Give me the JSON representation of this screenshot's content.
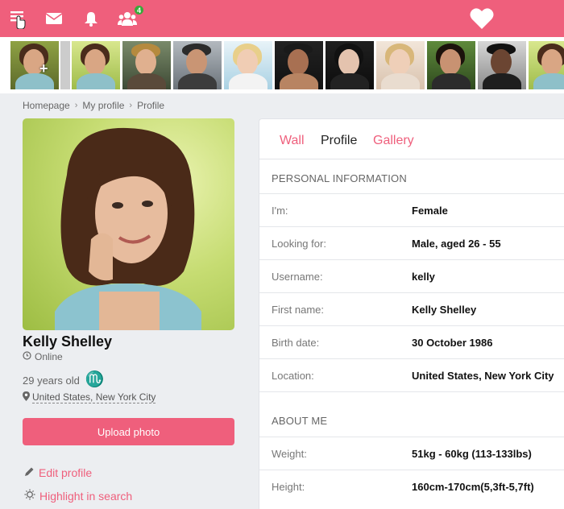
{
  "topbar": {
    "menu_icon": "hamburger-menu-icon",
    "mail_icon": "envelope-icon",
    "bell_icon": "bell-icon",
    "group_icon": "group-users-icon",
    "group_badge": "4",
    "heart_icon": "heart-logo-icon",
    "bg_color": "#ef5f7c"
  },
  "breadcrumb": {
    "items": [
      "Homepage",
      "My profile",
      "Profile"
    ]
  },
  "profile": {
    "name": "Kelly Shelley",
    "status": "Online",
    "age": "29 years old",
    "zodiac_symbol": "♏",
    "location": "United States, New York City",
    "upload_label": "Upload photo",
    "edit_label": "Edit profile",
    "highlight_label": "Highlight in search"
  },
  "tabs": [
    "Wall",
    "Profile",
    "Gallery"
  ],
  "personal": {
    "heading": "PERSONAL INFORMATION",
    "rows": [
      {
        "label": "I'm:",
        "value": "Female"
      },
      {
        "label": "Looking for:",
        "value": "Male, aged 26 - 55"
      },
      {
        "label": "Username:",
        "value": "kelly"
      },
      {
        "label": "First name:",
        "value": "Kelly Shelley"
      },
      {
        "label": "Birth date:",
        "value": "30 October 1986"
      },
      {
        "label": "Location:",
        "value": "United States, New York City"
      }
    ]
  },
  "about": {
    "heading": "ABOUT ME",
    "rows": [
      {
        "label": "Weight:",
        "value": "51kg - 60kg (113-133lbs)"
      },
      {
        "label": "Height:",
        "value": "160cm-170cm(5,3ft-5,7ft)"
      }
    ]
  },
  "colors": {
    "accent": "#ef5f7c",
    "online_green": "#3aa83a",
    "zodiac": "#2a9bbf"
  }
}
